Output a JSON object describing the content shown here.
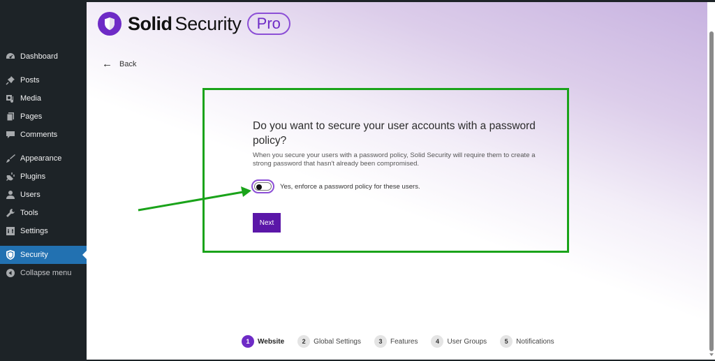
{
  "sidebar": {
    "items": [
      {
        "label": "Dashboard",
        "icon": "dashboard-icon"
      },
      {
        "label": "Posts",
        "icon": "pin-icon"
      },
      {
        "label": "Media",
        "icon": "media-icon"
      },
      {
        "label": "Pages",
        "icon": "pages-icon"
      },
      {
        "label": "Comments",
        "icon": "comment-icon"
      },
      {
        "label": "Appearance",
        "icon": "brush-icon"
      },
      {
        "label": "Plugins",
        "icon": "plug-icon"
      },
      {
        "label": "Users",
        "icon": "user-icon"
      },
      {
        "label": "Tools",
        "icon": "wrench-icon"
      },
      {
        "label": "Settings",
        "icon": "settings-icon"
      },
      {
        "label": "Security",
        "icon": "shield-icon",
        "active": true
      },
      {
        "label": "Collapse menu",
        "icon": "collapse-icon"
      }
    ]
  },
  "header": {
    "brand_bold": "Solid",
    "brand_regular": "Security",
    "brand_badge": "Pro",
    "back_label": "Back"
  },
  "card": {
    "title": "Do you want to secure your user accounts with a password policy?",
    "description": "When you secure your users with a password policy, Solid Security will require them to create a strong password that hasn't already been compromised.",
    "toggle_label": "Yes, enforce a password policy for these users.",
    "toggle_on": false,
    "next_label": "Next"
  },
  "steps": [
    {
      "num": "1",
      "label": "Website",
      "active": true
    },
    {
      "num": "2",
      "label": "Global Settings"
    },
    {
      "num": "3",
      "label": "Features"
    },
    {
      "num": "4",
      "label": "User Groups"
    },
    {
      "num": "5",
      "label": "Notifications"
    }
  ],
  "colors": {
    "accent": "#6e2bc6",
    "button": "#5b17a8",
    "annotation": "#1aa31a",
    "wp_active": "#2271b1"
  }
}
